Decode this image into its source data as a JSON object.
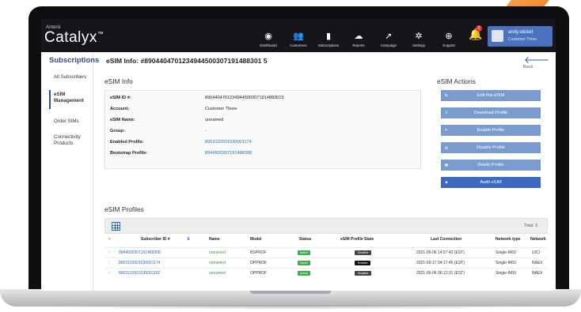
{
  "app": {
    "brand_small": "Anterix",
    "brand": "Catalyx",
    "brand_mark": "™"
  },
  "nav": [
    {
      "label": "Dashboard",
      "icon": "dashboard-icon",
      "glyph": "◉"
    },
    {
      "label": "Customers",
      "icon": "customers-icon",
      "glyph": "👥"
    },
    {
      "label": "Subscriptions",
      "icon": "subscriptions-icon",
      "glyph": "▮"
    },
    {
      "label": "Reports",
      "icon": "reports-icon",
      "glyph": "☁"
    },
    {
      "label": "Campaign",
      "icon": "campaign-icon",
      "glyph": "➚"
    },
    {
      "label": "Settings",
      "icon": "settings-icon",
      "glyph": "✲"
    },
    {
      "label": "Support",
      "icon": "support-icon",
      "glyph": "⊕"
    }
  ],
  "notifications": {
    "count": "2"
  },
  "user": {
    "name": "andy.sticket",
    "org": "Customer Three"
  },
  "sidebar": {
    "title": "Subscriptions",
    "items": [
      {
        "label": "All Subscribers"
      },
      {
        "label": "eSIM Management"
      },
      {
        "label": "Order SIMs"
      },
      {
        "label": "Connectivity Products"
      }
    ]
  },
  "page": {
    "title": "eSIM Info: #8904404701234944500307191488301 5",
    "back_label": "Back"
  },
  "info": {
    "title": "eSIM Info",
    "rows": [
      {
        "key": "eSIM ID #:",
        "value": "89044047012349445003071914883015"
      },
      {
        "key": "Account:",
        "value": "Customer Three"
      },
      {
        "key": "eSIM Name:",
        "value": "unnamed"
      },
      {
        "key": "Group:",
        "value": "-"
      },
      {
        "key": "Enabled Profile:",
        "value": "8953132601030001174"
      },
      {
        "key": "Bootstrap Profile:",
        "value": "8944500307191488308"
      }
    ]
  },
  "actions": {
    "title": "eSIM Actions",
    "buttons": [
      {
        "label": "Edit this eSIM",
        "glyph": "✎"
      },
      {
        "label": "Download Profile",
        "glyph": "⭳"
      },
      {
        "label": "Enable Profile",
        "glyph": "◐"
      },
      {
        "label": "Disable Profile",
        "glyph": "⊖"
      },
      {
        "label": "Delete Profile",
        "glyph": "✖"
      },
      {
        "label": "Audit eSIM",
        "glyph": "▲"
      }
    ]
  },
  "profiles": {
    "title": "eSIM Profiles",
    "total_label": "Total: 3",
    "columns": [
      "Subscriber ID #",
      "Name",
      "Model",
      "Status",
      "eSIM Profile State",
      "Last Connection",
      "Network type",
      "Network"
    ],
    "rows": [
      {
        "id": "8944500307191488308",
        "name": "unnamed",
        "model": "BSPROF",
        "status": "Active",
        "state": "Disabled",
        "last": "2021-06-06 14:57:42 (EST)",
        "type": "Single-IMSI",
        "network": "UICI"
      },
      {
        "id": "8953132601030001174",
        "name": "unnamed",
        "model": "OPPROF",
        "status": "Active",
        "state": "Enabled",
        "last": "2021-09-17 04:17:45 (EST)",
        "type": "Single-IMSI",
        "network": "NAEX"
      },
      {
        "id": "8953132601030001182",
        "name": "unnamed",
        "model": "OPPROF",
        "status": "Active",
        "state": "Disabled",
        "last": "2021-06-06 06:12:31 (EST)",
        "type": "Single-IMSI",
        "network": "NAEX"
      }
    ]
  }
}
